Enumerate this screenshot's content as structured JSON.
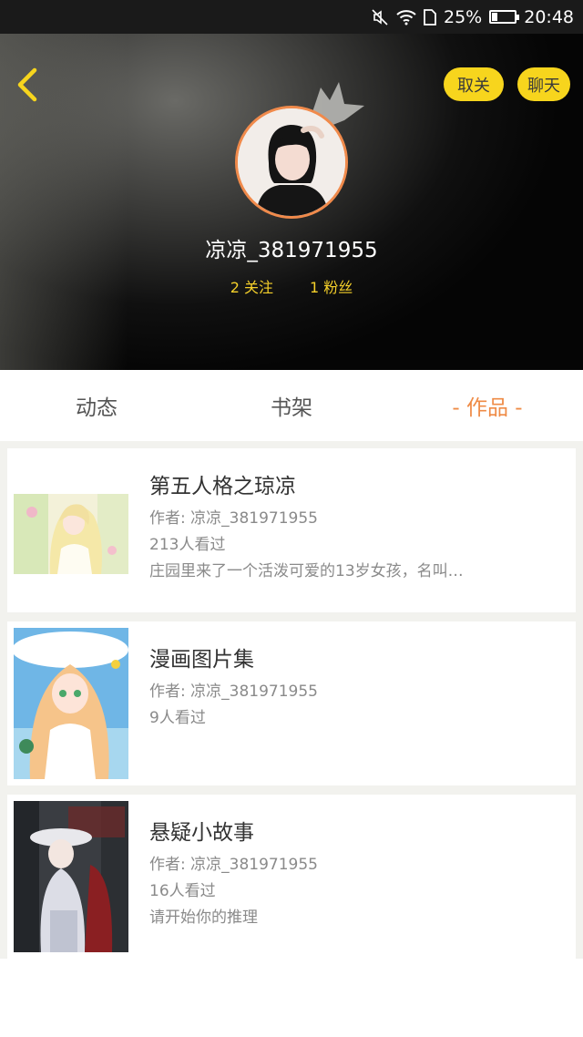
{
  "status_bar": {
    "battery": "25%",
    "battery_level": 0.25,
    "time": "20:48",
    "icons": [
      "mute-icon",
      "wifi-icon",
      "sim-icon",
      "battery-icon"
    ]
  },
  "header": {
    "back_icon": "chevron-left-icon",
    "unfollow_label": "取关",
    "chat_label": "聊天",
    "username": "凉凉_381971955",
    "following": "2 关注",
    "fans": "1 粉丝",
    "colors": {
      "accent": "#f7d51d",
      "stats": "#f5d02a",
      "avatar_ring": "#f08a4b"
    }
  },
  "tabs": [
    {
      "label": "动态",
      "active": false
    },
    {
      "label": "书架",
      "active": false
    },
    {
      "label": "- 作品 -",
      "active": true
    }
  ],
  "works": [
    {
      "title": "第五人格之琼凉",
      "author": "作者: 凉凉_381971955",
      "views": "213人看过",
      "desc": "庄园里来了一个活泼可爱的13岁女孩，名叫…"
    },
    {
      "title": "漫画图片集",
      "author": "作者: 凉凉_381971955",
      "views": "9人看过",
      "desc": ""
    },
    {
      "title": "悬疑小故事",
      "author": "作者: 凉凉_381971955",
      "views": "16人看过",
      "desc": "请开始你的推理"
    }
  ]
}
